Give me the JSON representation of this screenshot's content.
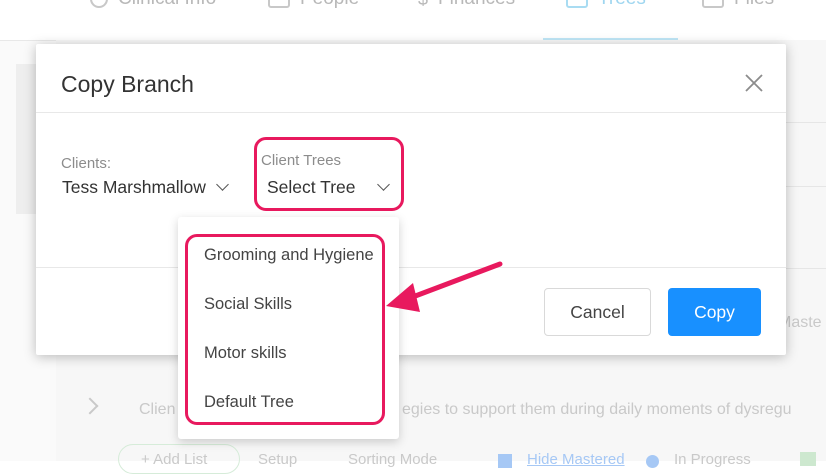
{
  "background": {
    "tabs": [
      {
        "label": "Clinical Info",
        "icon": "stethoscope-icon"
      },
      {
        "label": "People",
        "icon": "id-card-icon"
      },
      {
        "label": "Finances",
        "icon": "dollar-icon"
      },
      {
        "label": "Trees",
        "icon": "tree-icon",
        "active": true
      },
      {
        "label": "Files",
        "icon": "file-icon"
      }
    ],
    "faded_right_text": "Maste",
    "faded_row_left": "Clien",
    "faded_row_right": "egies to support them during daily moments of dysregu",
    "toolbar": {
      "add_list": "+ Add List",
      "setup": "Setup",
      "sorting_mode": "Sorting Mode",
      "hide_mastered": "Hide Mastered",
      "in_progress": "In Progress"
    }
  },
  "modal": {
    "title": "Copy Branch",
    "clients_label": "Clients:",
    "clients_value": "Tess Marshmallow",
    "trees_label": "Client Trees",
    "trees_value": "Select Tree",
    "cancel_label": "Cancel",
    "copy_label": "Copy"
  },
  "dropdown": {
    "options": [
      "Grooming and Hygiene",
      "Social Skills",
      "Motor skills",
      "Default Tree"
    ]
  },
  "colors": {
    "primary": "#1890ff",
    "annotation": "#e8195e"
  }
}
